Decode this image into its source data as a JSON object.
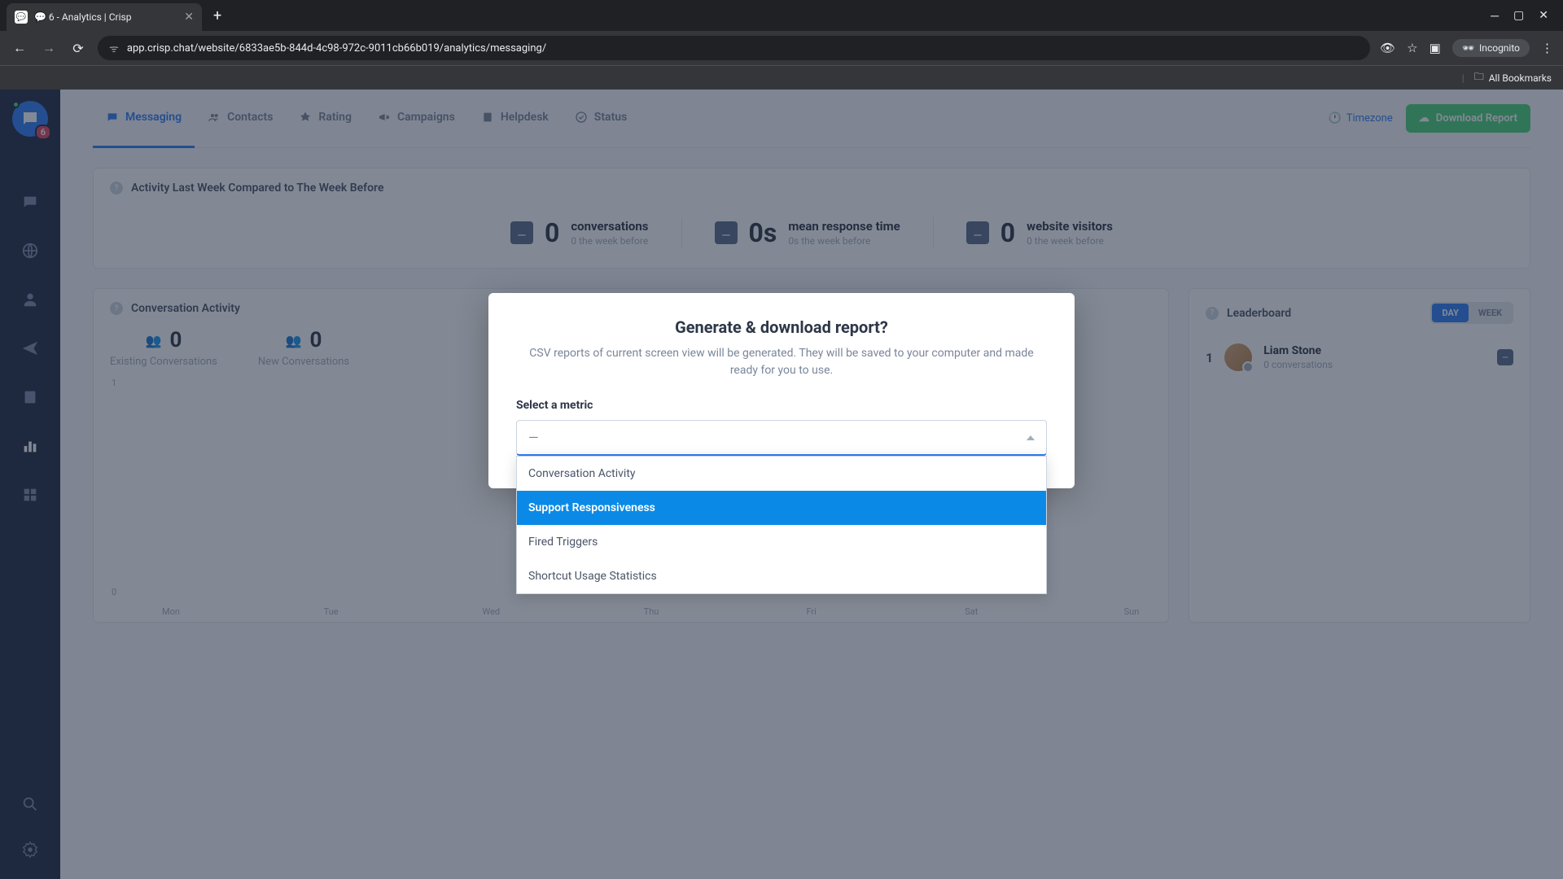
{
  "browser": {
    "tab_title": "💬 6 - Analytics | Crisp",
    "url": "app.crisp.chat/website/6833ae5b-844d-4c98-972c-9011cb66b019/analytics/messaging/",
    "incognito": "Incognito",
    "all_bookmarks": "All Bookmarks"
  },
  "sidebar": {
    "badge": "6"
  },
  "tabs": {
    "items": [
      {
        "label": "Messaging"
      },
      {
        "label": "Contacts"
      },
      {
        "label": "Rating"
      },
      {
        "label": "Campaigns"
      },
      {
        "label": "Helpdesk"
      },
      {
        "label": "Status"
      }
    ],
    "timezone": "Timezone",
    "download": "Download Report"
  },
  "summary": {
    "title": "Activity Last Week Compared to The Week Before",
    "stats": [
      {
        "value": "0",
        "label": "conversations",
        "sub": "0 the week before"
      },
      {
        "value": "0s",
        "label": "mean response time",
        "sub": "0s the week before"
      },
      {
        "value": "0",
        "label": "website visitors",
        "sub": "0 the week before"
      }
    ]
  },
  "activity": {
    "title": "Conversation Activity",
    "period_day": "DAY",
    "period_week": "WEEK",
    "counters": [
      {
        "value": "0",
        "label": "Existing Conversations"
      },
      {
        "value": "0",
        "label": "New Conversations"
      }
    ]
  },
  "chart_data": {
    "type": "bar",
    "categories": [
      "Mon",
      "Tue",
      "Wed",
      "Thu",
      "Fri",
      "Sat",
      "Sun"
    ],
    "series": [
      {
        "name": "Existing Conversations",
        "values": [
          0,
          0,
          0,
          0,
          0,
          0,
          0
        ]
      },
      {
        "name": "New Conversations",
        "values": [
          0,
          0,
          0,
          0,
          0,
          0,
          0
        ]
      }
    ],
    "ylim": [
      0,
      1
    ],
    "yticks": [
      1,
      0
    ],
    "xlabel": "",
    "ylabel": ""
  },
  "leaderboard": {
    "title": "Leaderboard",
    "items": [
      {
        "rank": "1",
        "name": "Liam Stone",
        "sub": "0 conversations"
      }
    ]
  },
  "modal": {
    "title": "Generate & download report?",
    "desc": "CSV reports of current screen view will be generated. They will be saved to your computer and made ready for you to use.",
    "select_label": "Select a metric",
    "select_placeholder": "—",
    "options": [
      "Conversation Activity",
      "Support Responsiveness",
      "Fired Triggers",
      "Shortcut Usage Statistics"
    ],
    "highlighted_index": 1
  }
}
